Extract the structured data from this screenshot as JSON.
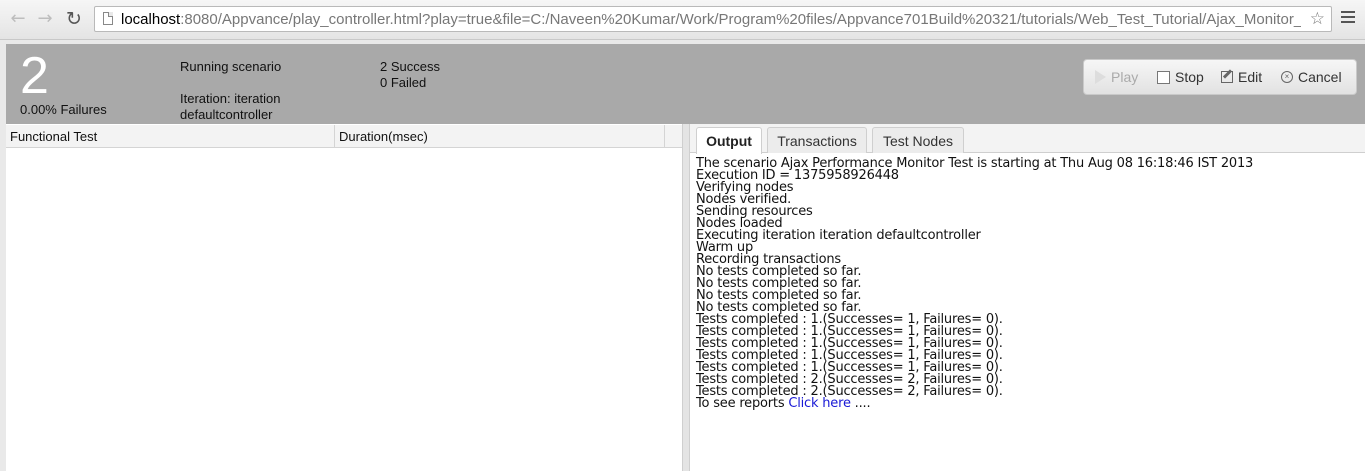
{
  "browser": {
    "url_host": "localhost",
    "url_rest": ":8080/Appvance/play_controller.html?play=true&file=C:/Naveen%20Kumar/Work/Program%20files/Appvance701Build%20321/tutorials/Web_Test_Tutorial/Ajax_Monitor_",
    "back_icon": "arrow-left",
    "forward_icon": "arrow-right",
    "reload_icon": "reload",
    "star_icon": "star-outline",
    "menu_icon": "hamburger"
  },
  "status": {
    "count": "2",
    "failures": "0.00% Failures",
    "running": "Running scenario",
    "iteration_line1": "Iteration: iteration",
    "iteration_line2": "defaultcontroller",
    "success": "2 Success",
    "failed": "0 Failed"
  },
  "controls": {
    "play": "Play",
    "stop": "Stop",
    "edit": "Edit",
    "cancel": "Cancel"
  },
  "table": {
    "columns": [
      "Functional Test",
      "Duration(msec)"
    ]
  },
  "tabs": [
    "Output",
    "Transactions",
    "Test Nodes"
  ],
  "output": {
    "lines": [
      "The scenario Ajax Performance Monitor Test is starting at Thu Aug 08 16:18:46 IST 2013",
      "Execution ID = 1375958926448",
      "Verifying nodes",
      "Nodes verified.",
      "Sending resources",
      "Nodes loaded",
      "Executing iteration iteration defaultcontroller",
      "Warm up",
      "Recording transactions",
      "No tests completed so far.",
      "No tests completed so far.",
      "No tests completed so far.",
      "No tests completed so far.",
      "Tests completed : 1.(Successes= 1, Failures= 0).",
      "Tests completed : 1.(Successes= 1, Failures= 0).",
      "Tests completed : 1.(Successes= 1, Failures= 0).",
      "Tests completed : 1.(Successes= 1, Failures= 0).",
      "Tests completed : 1.(Successes= 1, Failures= 0).",
      "Tests completed : 2.(Successes= 2, Failures= 0).",
      "Tests completed : 2.(Successes= 2, Failures= 0)."
    ],
    "report_prefix": "To see reports ",
    "report_link": "Click here",
    "report_suffix": " ...."
  },
  "colors": {
    "status_bar": "#a9a9a9",
    "link": "#1a1ad6"
  }
}
